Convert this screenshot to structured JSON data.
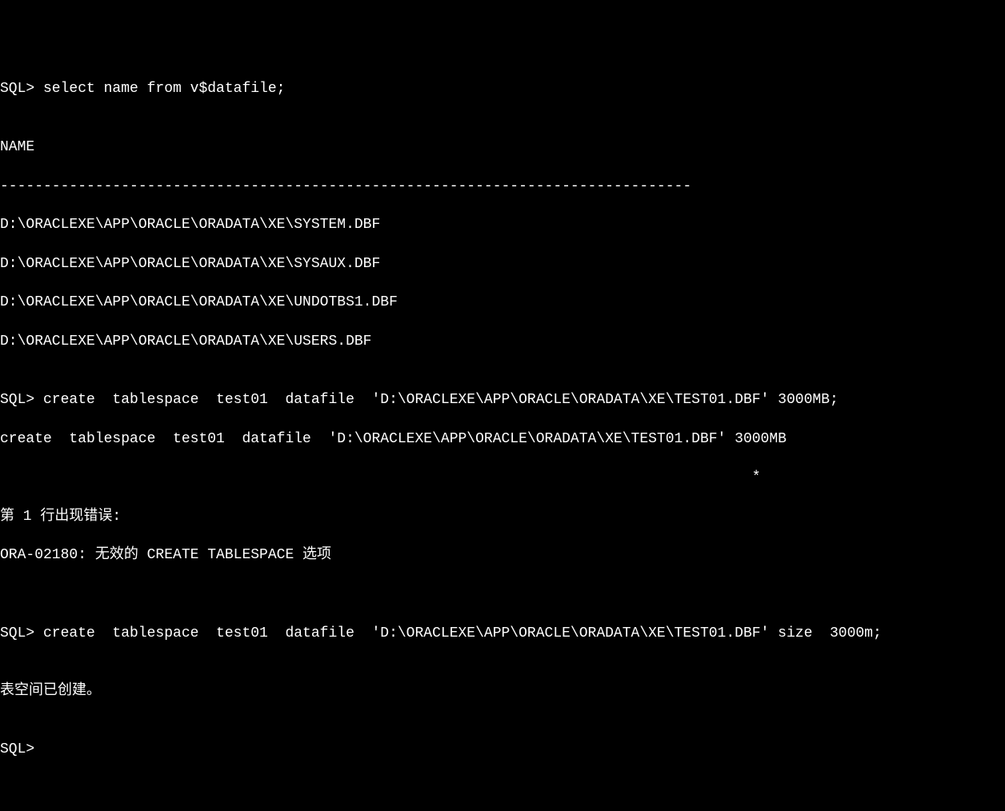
{
  "lines": {
    "l1": "SQL> select name from v$datafile;",
    "l2": "NAME",
    "l3": "--------------------------------------------------------------------------------",
    "l4": "D:\\ORACLEXE\\APP\\ORACLE\\ORADATA\\XE\\SYSTEM.DBF",
    "l5": "D:\\ORACLEXE\\APP\\ORACLE\\ORADATA\\XE\\SYSAUX.DBF",
    "l6": "D:\\ORACLEXE\\APP\\ORACLE\\ORADATA\\XE\\UNDOTBS1.DBF",
    "l7": "D:\\ORACLEXE\\APP\\ORACLE\\ORADATA\\XE\\USERS.DBF",
    "l8": "SQL> create  tablespace  test01  datafile  'D:\\ORACLEXE\\APP\\ORACLE\\ORADATA\\XE\\TEST01.DBF' 3000MB;",
    "l9": "create  tablespace  test01  datafile  'D:\\ORACLEXE\\APP\\ORACLE\\ORADATA\\XE\\TEST01.DBF' 3000MB",
    "l10": "                                                                                       *",
    "l11": "第 1 行出现错误:",
    "l12": "ORA-02180: 无效的 CREATE TABLESPACE 选项",
    "l13": "SQL> create  tablespace  test01  datafile  'D:\\ORACLEXE\\APP\\ORACLE\\ORADATA\\XE\\TEST01.DBF' size  3000m;",
    "l14": "表空间已创建。",
    "l15": "SQL> "
  }
}
